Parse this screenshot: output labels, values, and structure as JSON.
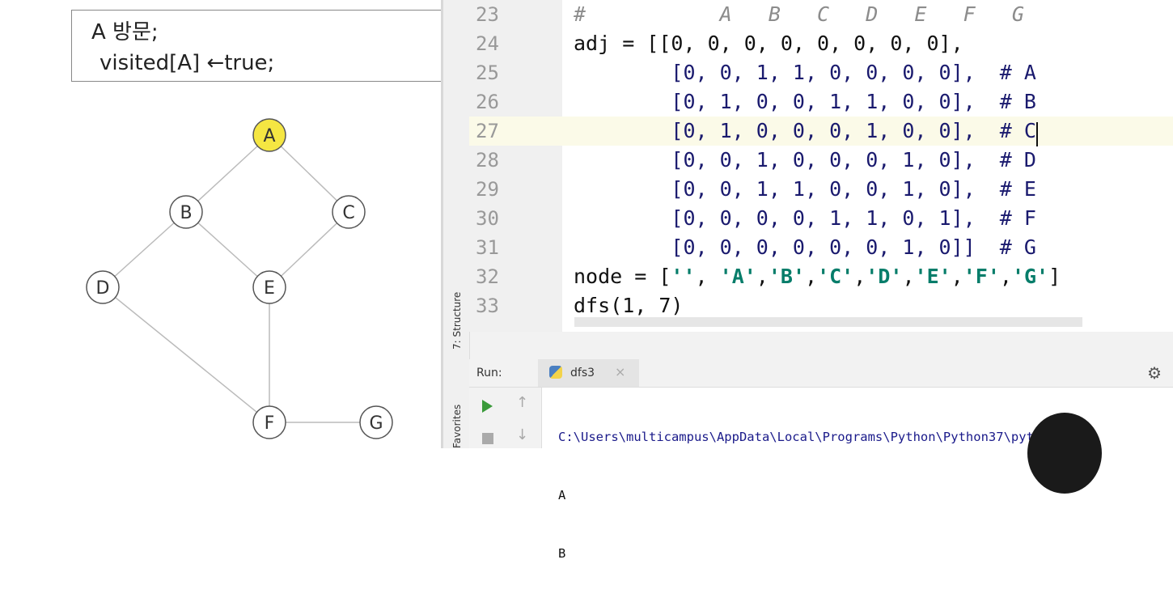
{
  "slide": {
    "pseudo_line1": "A 방문;",
    "pseudo_line2": "visited[A] ←true;",
    "graph": {
      "highlight_color": "#f5e642",
      "nodes": [
        {
          "id": "A",
          "visited": true
        },
        {
          "id": "B",
          "visited": false
        },
        {
          "id": "C",
          "visited": false
        },
        {
          "id": "D",
          "visited": false
        },
        {
          "id": "E",
          "visited": false
        },
        {
          "id": "F",
          "visited": false
        },
        {
          "id": "G",
          "visited": false
        }
      ],
      "edges": [
        [
          "A",
          "B"
        ],
        [
          "A",
          "C"
        ],
        [
          "B",
          "D"
        ],
        [
          "B",
          "E"
        ],
        [
          "C",
          "E"
        ],
        [
          "D",
          "F"
        ],
        [
          "E",
          "F"
        ],
        [
          "F",
          "G"
        ]
      ]
    }
  },
  "ide": {
    "toolstrip": {
      "structure": "7: Structure",
      "favorites": "Favorites"
    },
    "editor": {
      "current_line": "27",
      "lines": [
        {
          "n": "23",
          "text": "#           A   B   C   D   E   F   G"
        },
        {
          "n": "24",
          "text": "adj = [[0, 0, 0, 0, 0, 0, 0, 0],"
        },
        {
          "n": "25",
          "text": "        [0, 0, 1, 1, 0, 0, 0, 0],  # A"
        },
        {
          "n": "26",
          "text": "        [0, 1, 0, 0, 1, 1, 0, 0],  # B"
        },
        {
          "n": "27",
          "text": "        [0, 1, 0, 0, 0, 1, 0, 0],  # C"
        },
        {
          "n": "28",
          "text": "        [0, 0, 1, 0, 0, 0, 1, 0],  # D"
        },
        {
          "n": "29",
          "text": "        [0, 0, 1, 1, 0, 0, 1, 0],  # E"
        },
        {
          "n": "30",
          "text": "        [0, 0, 0, 0, 1, 1, 0, 1],  # F"
        },
        {
          "n": "31",
          "text": "        [0, 0, 0, 0, 0, 0, 1, 0]]  # G"
        },
        {
          "n": "32",
          "text": "node = ['', 'A','B','C','D','E','F','G']"
        },
        {
          "n": "33",
          "text": "dfs(1, 7)"
        }
      ]
    },
    "run": {
      "label": "Run:",
      "tab": "dfs3",
      "close": "×",
      "gear": "⚙",
      "up": "↑",
      "down": "↓",
      "output": [
        "C:\\Users\\multicampus\\AppData\\Local\\Programs\\Python\\Python37\\python",
        "A",
        "B"
      ]
    }
  }
}
